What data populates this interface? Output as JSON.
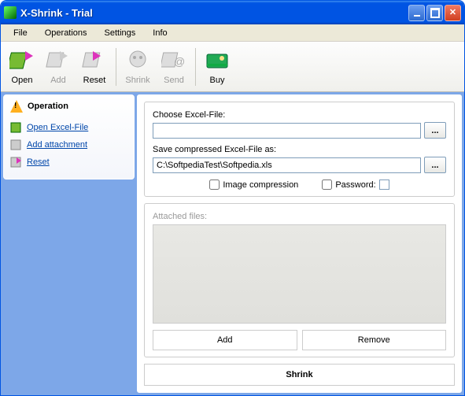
{
  "window": {
    "title": "X-Shrink - Trial"
  },
  "menubar": [
    "File",
    "Operations",
    "Settings",
    "Info"
  ],
  "toolbar": {
    "open": "Open",
    "add": "Add",
    "reset": "Reset",
    "shrink": "Shrink",
    "send": "Send",
    "buy": "Buy"
  },
  "sidebar": {
    "header": "Operation",
    "links": {
      "open": "Open Excel-File",
      "attach": "Add attachment",
      "reset": "Reset"
    }
  },
  "main": {
    "choose_label": "Choose Excel-File:",
    "choose_value": "",
    "save_label": "Save compressed Excel-File as:",
    "save_value": "C:\\SoftpediaTest\\Softpedia.xls",
    "browse": "...",
    "image_compression": "Image compression",
    "password_label": "Password:",
    "password_value": "",
    "attached_label": "Attached files:",
    "add_btn": "Add",
    "remove_btn": "Remove",
    "shrink_btn": "Shrink"
  }
}
